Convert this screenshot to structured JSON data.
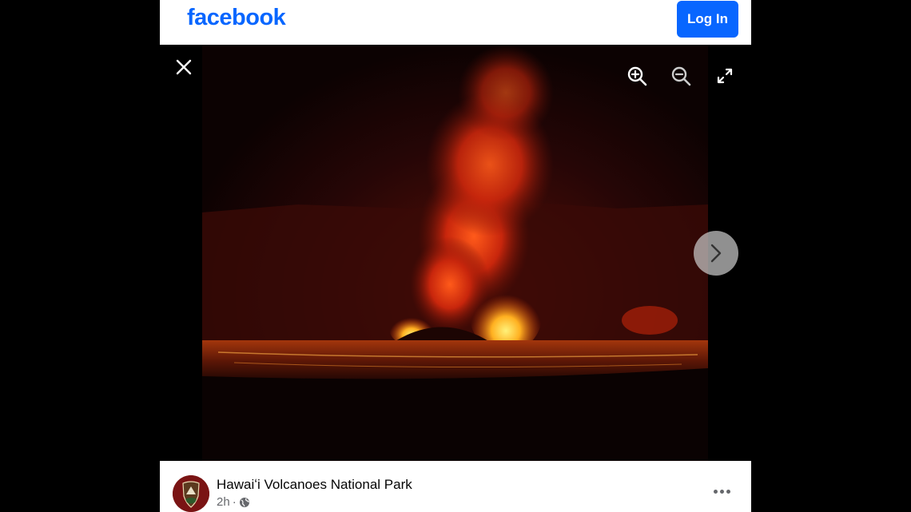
{
  "header": {
    "logo_text": "facebook",
    "login_label": "Log In",
    "brand_color": "#0866ff"
  },
  "viewer": {
    "close_icon": "close-icon",
    "zoom_in_icon": "zoom-in-icon",
    "zoom_out_icon": "zoom-out-icon",
    "fullscreen_icon": "fullscreen-icon",
    "next_icon": "chevron-right-icon"
  },
  "post": {
    "page_name": "Hawaiʻi Volcanoes National Park",
    "time": "2h",
    "separator": "·",
    "audience_icon": "globe-icon",
    "more_icon": "more-options-icon"
  }
}
